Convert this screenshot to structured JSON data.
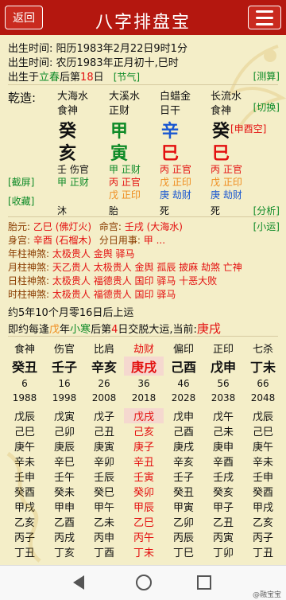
{
  "header": {
    "back_label": "返回",
    "logo_text": "八字排盘宝"
  },
  "info": {
    "line1": "出生时间: 阳历1983年2月22日9时1分",
    "line2": "出生时间: 农历1983年正月初十,巳时",
    "line3_pre": "出生于",
    "line3_term": "立春",
    "line3_mid": "后第",
    "line3_day": "18",
    "line3_post": "日",
    "line3_tag": "[节气]",
    "tag_measure": "[测算]"
  },
  "qianzao": {
    "label": "乾造:",
    "switch_tag": "[切换]",
    "nayin": [
      "大海水",
      "大溪水",
      "白蜡金",
      "长流水"
    ],
    "shishen_top": [
      "食神",
      "正财",
      "日干",
      "食神"
    ],
    "stems": [
      "癸",
      "甲",
      "辛",
      "癸"
    ],
    "branches": [
      "亥",
      "寅",
      "巳",
      "巳"
    ],
    "kongwang": "[申酉空]",
    "hidden": [
      [
        "壬 伤官",
        "甲 正财"
      ],
      [
        "甲 正财",
        "丙 正官",
        "戊 正印"
      ],
      [
        "丙 正官",
        "戊 正印",
        "庚 劫财"
      ],
      [
        "丙 正官",
        "戊 正印",
        "庚 劫财"
      ]
    ],
    "screenshot_tag": "[截屏]",
    "collect_tag": "[收藏]",
    "analysis_tag": "[分析]",
    "state": [
      "沐",
      "胎",
      "死",
      "死"
    ]
  },
  "extra": {
    "taiyuan_label": "胎元:",
    "taiyuan_value": "乙巳 (佛灯火)",
    "minggong_label": "命宫:",
    "minggong_value": "壬戌 (大海水)",
    "xiaoyun_tag": "[小运]",
    "shengong_label": "身宫:",
    "shengong_value": "辛酉 (石榴木)",
    "fenri_label": "分日用事:",
    "fenri_value": "甲 ...",
    "year_label": "年柱神煞:",
    "year_value": "太极贵人 金舆 驿马",
    "month_label": "月柱神煞:",
    "month_value": "天乙贵人 太极贵人 金舆 孤辰 披麻 劫煞 亡神",
    "day_label": "日柱神煞:",
    "day_value": "太极贵人 福德贵人 国印 驿马 十恶大败",
    "hour_label": "时柱神煞:",
    "hour_value": "太极贵人 福德贵人 国印 驿马",
    "qiyun": "约5年10个月零16日后上运",
    "jiaoyun_pre": "即约每逢",
    "jiaoyun_stem": "戊",
    "jiaoyun_mid1": "年",
    "jiaoyun_term": "小寒",
    "jiaoyun_mid2": "后第",
    "jiaoyun_day": "4",
    "jiaoyun_post": "日交脱大运,当前:",
    "jiaoyun_current": "庚戌"
  },
  "dayun": {
    "shishen": [
      "食神",
      "伤官",
      "比肩",
      "劫财",
      "偏印",
      "正印",
      "七杀"
    ],
    "pillars": [
      "癸丑",
      "壬子",
      "辛亥",
      "庚戌",
      "己酉",
      "戊申",
      "丁未"
    ],
    "ages": [
      "6",
      "16",
      "26",
      "36",
      "46",
      "56",
      "66"
    ],
    "years": [
      "1988",
      "1998",
      "2008",
      "2018",
      "2028",
      "2038",
      "2048"
    ],
    "liunian": [
      [
        "戊辰",
        "戊寅",
        "戊子",
        "戊戌",
        "戊申",
        "戊午",
        "戊辰"
      ],
      [
        "己巳",
        "己卯",
        "己丑",
        "己亥",
        "己酉",
        "己未",
        "己巳"
      ],
      [
        "庚午",
        "庚辰",
        "庚寅",
        "庚子",
        "庚戌",
        "庚申",
        "庚午"
      ],
      [
        "辛未",
        "辛巳",
        "辛卯",
        "辛丑",
        "辛亥",
        "辛酉",
        "辛未"
      ],
      [
        "壬申",
        "壬午",
        "壬辰",
        "壬寅",
        "壬子",
        "壬戌",
        "壬申"
      ],
      [
        "癸酉",
        "癸未",
        "癸巳",
        "癸卯",
        "癸丑",
        "癸亥",
        "癸酉"
      ],
      [
        "甲戌",
        "甲申",
        "甲午",
        "甲辰",
        "甲寅",
        "甲子",
        "甲戌"
      ],
      [
        "乙亥",
        "乙酉",
        "乙未",
        "乙巳",
        "乙卯",
        "乙丑",
        "乙亥"
      ],
      [
        "丙子",
        "丙戌",
        "丙申",
        "丙午",
        "丙辰",
        "丙寅",
        "丙子"
      ],
      [
        "丁丑",
        "丁亥",
        "丁酉",
        "丁未",
        "丁巳",
        "丁卯",
        "丁丑"
      ]
    ]
  },
  "watermark": "@融宝宝",
  "colors": {
    "header_bg": "#b4170f",
    "page_bg": "#f4eec8",
    "accent_red": "#e30f0f",
    "accent_blue": "#1957d1",
    "accent_green": "#0d8a27"
  }
}
